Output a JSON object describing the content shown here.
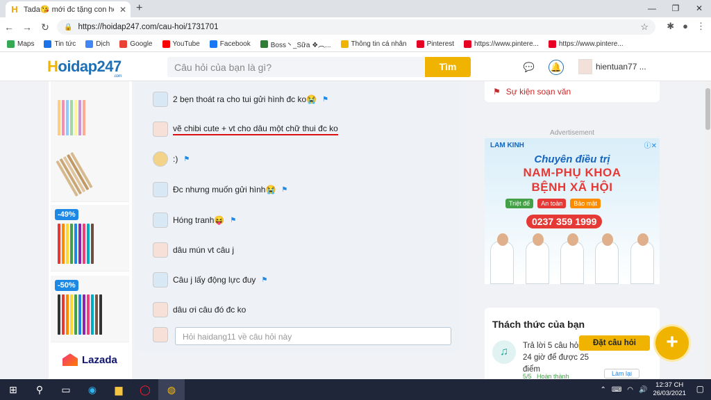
{
  "browser": {
    "tab_title": "Tada😘 mới đc tặng con heo cute",
    "url": "https://hoidap247.com/cau-hoi/1731701",
    "bookmarks": [
      {
        "label": "Maps",
        "color": "#34a853"
      },
      {
        "label": "Tin tức",
        "color": "#1a73e8"
      },
      {
        "label": "Dịch",
        "color": "#4285f4"
      },
      {
        "label": "Google",
        "color": "#ea4335"
      },
      {
        "label": "YouTube",
        "color": "#ff0000"
      },
      {
        "label": "Facebook",
        "color": "#1877f2"
      },
      {
        "label": "Boss丶_Sữa ❖︵...",
        "color": "#2e7d32"
      },
      {
        "label": "Thông tin cá nhân",
        "color": "#f0b400"
      },
      {
        "label": "Pinterest",
        "color": "#e60023"
      },
      {
        "label": "https://www.pintere...",
        "color": "#e60023"
      },
      {
        "label": "https://www.pintere...",
        "color": "#e60023"
      }
    ]
  },
  "header": {
    "logo_h": "H",
    "logo_text": "oidap247",
    "logo_sub": ".com",
    "search_placeholder": "Câu hỏi của bạn là gì?",
    "search_button": "Tìm",
    "username": "hientuan77 ..."
  },
  "left_ads": {
    "discount_1": "-49%",
    "discount_2": "-50%",
    "brand": "Lazada"
  },
  "comments": [
    {
      "text": "2 bẹn thoát ra cho tui gửi hình đc ko😭",
      "avatar": "boy"
    },
    {
      "text": "vẽ chibi cute + vt cho dâu một chữ thui đc ko",
      "avatar": "girl"
    },
    {
      "text": ":)",
      "avatar": "boy2"
    },
    {
      "text": "Đc nhưng muốn gửi hình😭",
      "avatar": "boy"
    },
    {
      "text": "Hóng tranh😝",
      "avatar": "boy"
    },
    {
      "text": "dâu mún vt câu j",
      "avatar": "girl"
    },
    {
      "text": "Câu j lấy động lực đuy",
      "avatar": "boy"
    },
    {
      "text": "dâu ơi  câu đó đc ko",
      "avatar": "girl"
    }
  ],
  "reply_placeholder": "Hỏi haidang11 về câu hỏi này",
  "sidebar": {
    "event_label": "Sự kiện soạn văn",
    "ad_label": "Advertisement",
    "ad": {
      "brand": "LAM KINH",
      "line1": "Chuyên điều trị",
      "line2": "NAM-PHỤ KHOA",
      "line3": "BỆNH XÃ HỘI",
      "tags": [
        "Triệt để",
        "An toàn",
        "Bảo mật"
      ],
      "phone": "0237 359 1999"
    },
    "challenge": {
      "title": "Thách thức của bạn",
      "text": "Trả lời 5 câu hỏi trong 24 giờ để được 25 điểm",
      "progress": "5/5",
      "status": "Hoàn thành",
      "retry": "Làm lại"
    },
    "ask_label": "Đặt câu hỏi"
  },
  "taskbar": {
    "time": "12:37 CH",
    "date": "26/03/2021"
  }
}
